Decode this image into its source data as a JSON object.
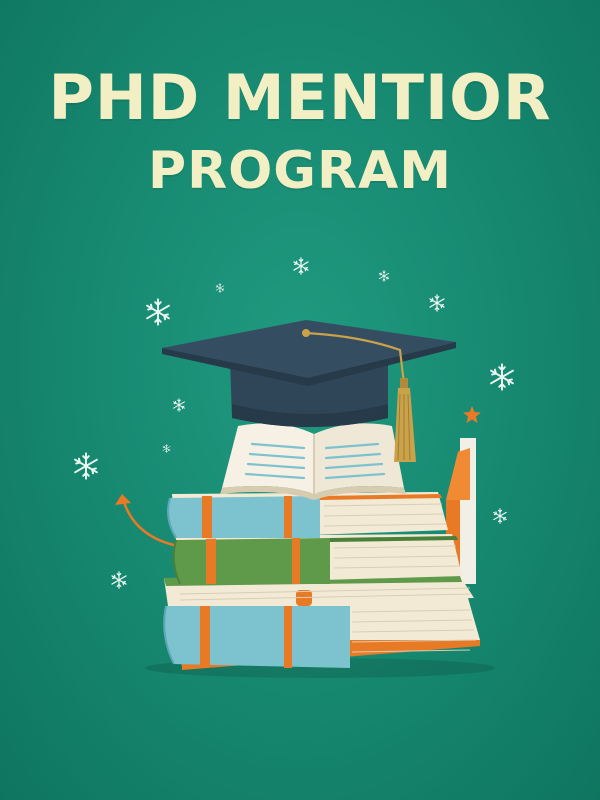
{
  "title": {
    "line1": "PHD MENTIOR",
    "line2": "PROGRAM"
  },
  "colors": {
    "background": "#16876f",
    "title": "#f3efc4",
    "cap": "#2f4658",
    "tassel": "#c9a24a",
    "accent_orange": "#e97a25",
    "book_blue": "#7cc3cf",
    "book_green": "#5e9a4a",
    "book_cream": "#f3ead6"
  },
  "icons": [
    "snowflake-icon",
    "sparkle-icon",
    "star-icon",
    "arrow-icon",
    "graduation-cap-icon",
    "open-book-icon",
    "book-stack-icon"
  ]
}
